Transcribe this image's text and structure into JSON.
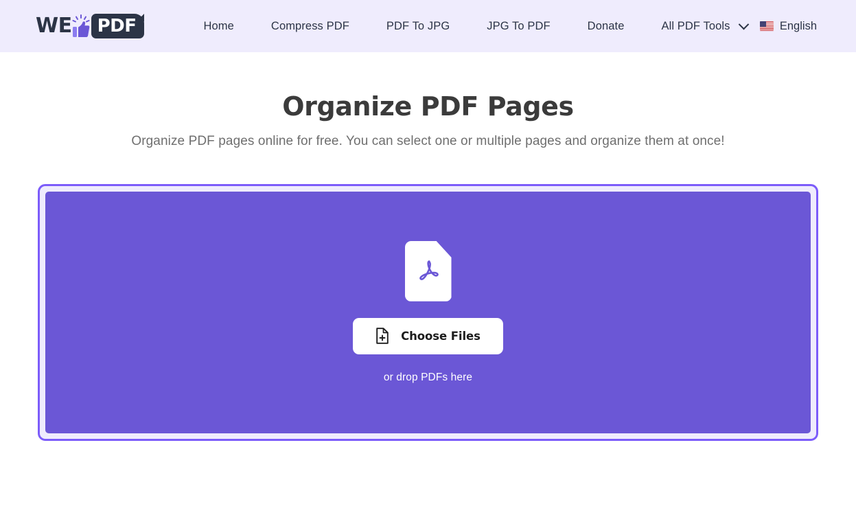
{
  "header": {
    "logo": {
      "text_dark": "WE",
      "text_light": "PDF",
      "thumb_icon": "thumbs-up-icon"
    },
    "nav": [
      {
        "label": "Home",
        "name": "nav-item-home"
      },
      {
        "label": "Compress PDF",
        "name": "nav-item-compress-pdf"
      },
      {
        "label": "PDF To JPG",
        "name": "nav-item-pdf-to-jpg"
      },
      {
        "label": "JPG To PDF",
        "name": "nav-item-jpg-to-pdf"
      },
      {
        "label": "Donate",
        "name": "nav-item-donate"
      },
      {
        "label": "All PDF Tools",
        "name": "nav-item-all-pdf-tools"
      }
    ],
    "language": {
      "label": "English",
      "flag_icon": "us-flag-icon"
    }
  },
  "main": {
    "title": "Organize PDF Pages",
    "subtitle": "Organize PDF pages online for free. You can select one or multiple pages and organize them at once!",
    "dropzone": {
      "file_icon": "pdf-file-icon",
      "choose_button_label": "Choose Files",
      "choose_button_icon": "file-plus-icon",
      "drop_hint": "or drop PDFs here"
    }
  },
  "colors": {
    "header_bg": "#efecfd",
    "dropzone_fill": "#6b57d6",
    "dropzone_border": "#7c5cfa",
    "logo_dark": "#2c3446",
    "title": "#3b3b3b",
    "subtitle": "#6f6f6f"
  }
}
